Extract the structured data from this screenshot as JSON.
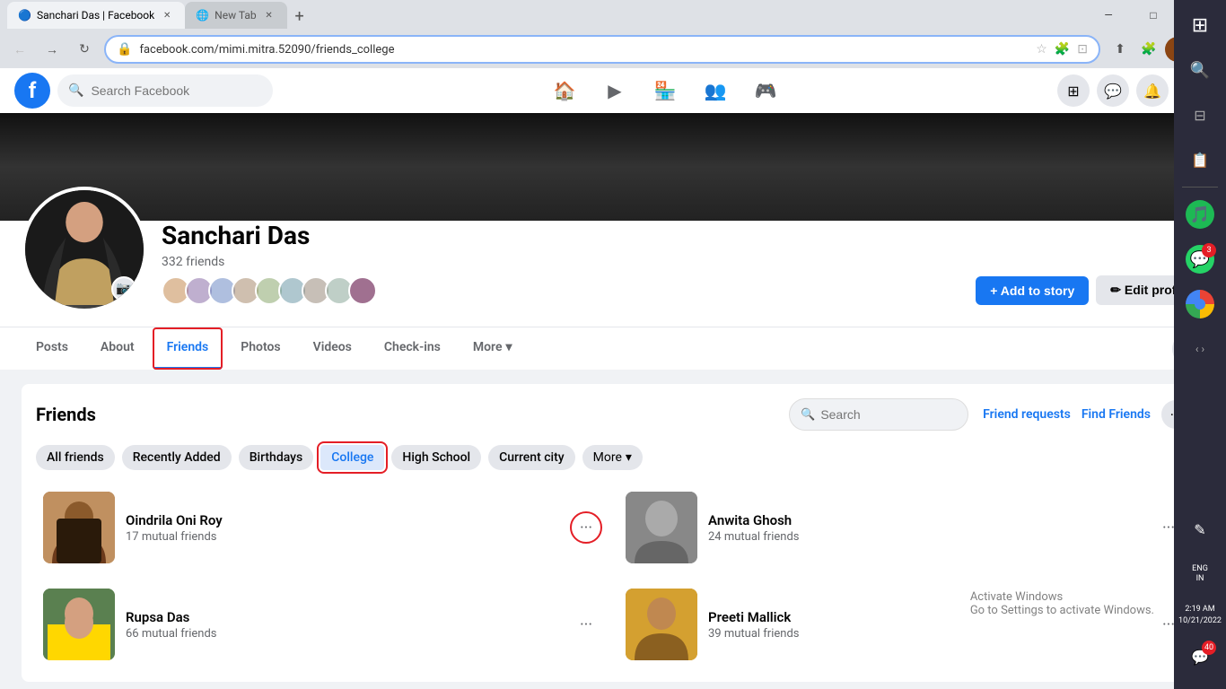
{
  "browser": {
    "tabs": [
      {
        "id": "tab1",
        "favicon": "🔵",
        "title": "Sanchari Das | Facebook",
        "active": true,
        "url": "facebook.com/mimi.mitra.52090/friends_college"
      },
      {
        "id": "tab2",
        "favicon": "🌐",
        "title": "New Tab",
        "active": false
      }
    ],
    "address": "facebook.com/mimi.mitra.52090/friends_college",
    "window_controls": {
      "minimize": "—",
      "maximize": "□",
      "close": "✕"
    }
  },
  "facebook": {
    "nav": {
      "search_placeholder": "Search Facebook",
      "icons": [
        "🏠",
        "▶",
        "🏪",
        "👥",
        "⊞"
      ],
      "right_icons": [
        "⊞",
        "💬",
        "🔔"
      ],
      "logo": "f"
    },
    "profile": {
      "name": "Sanchari Das",
      "friends_count": "332 friends",
      "cover_bg": "#1a1a1a",
      "buttons": {
        "add_story": "+ Add to story",
        "edit_profile": "✏ Edit profile"
      },
      "friends_avatars_count": 9
    },
    "tabs": [
      {
        "id": "posts",
        "label": "Posts",
        "active": false
      },
      {
        "id": "about",
        "label": "About",
        "active": false
      },
      {
        "id": "friends",
        "label": "Friends",
        "active": true,
        "highlighted": true
      },
      {
        "id": "photos",
        "label": "Photos",
        "active": false
      },
      {
        "id": "videos",
        "label": "Videos",
        "active": false
      },
      {
        "id": "checkins",
        "label": "Check-ins",
        "active": false
      },
      {
        "id": "more",
        "label": "More ▾",
        "active": false
      }
    ],
    "friends_section": {
      "title": "Friends",
      "search_placeholder": "Search",
      "actions": {
        "friend_requests": "Friend requests",
        "find_friends": "Find Friends"
      },
      "filters": [
        {
          "id": "all",
          "label": "All friends",
          "active": false
        },
        {
          "id": "recently_added",
          "label": "Recently Added",
          "active": false
        },
        {
          "id": "birthdays",
          "label": "Birthdays",
          "active": false
        },
        {
          "id": "college",
          "label": "College",
          "active": true,
          "highlighted": true
        },
        {
          "id": "high_school",
          "label": "High School",
          "active": false
        },
        {
          "id": "current_city",
          "label": "Current city",
          "active": false
        },
        {
          "id": "more",
          "label": "More ▾",
          "active": false
        }
      ],
      "friends": [
        {
          "id": "friend1",
          "name": "Oindrila Oni Roy",
          "mutual": "17 mutual friends",
          "photo_class": "friend-photo-1",
          "highlight_more": true
        },
        {
          "id": "friend2",
          "name": "Anwita Ghosh",
          "mutual": "24 mutual friends",
          "photo_class": "friend-photo-2",
          "highlight_more": false
        },
        {
          "id": "friend3",
          "name": "Rupsa Das",
          "mutual": "66 mutual friends",
          "photo_class": "friend-photo-3",
          "highlight_more": false
        },
        {
          "id": "friend4",
          "name": "Preeti Mallick",
          "mutual": "39 mutual friends",
          "photo_class": "friend-photo-4",
          "highlight_more": false
        }
      ]
    }
  },
  "right_panel": {
    "icons": [
      "⊞",
      "🔍",
      "⊟",
      "📋"
    ],
    "spotify_badge": "",
    "whatsapp_badge": "3",
    "chrome_badge": "",
    "bottom": {
      "lang": "ENG\nIN",
      "time": "2:19 AM",
      "date": "10/21/2022",
      "notif": "40"
    }
  },
  "watermark": {
    "line1": "Activate Windows",
    "line2": "Go to Settings to activate Windows."
  }
}
